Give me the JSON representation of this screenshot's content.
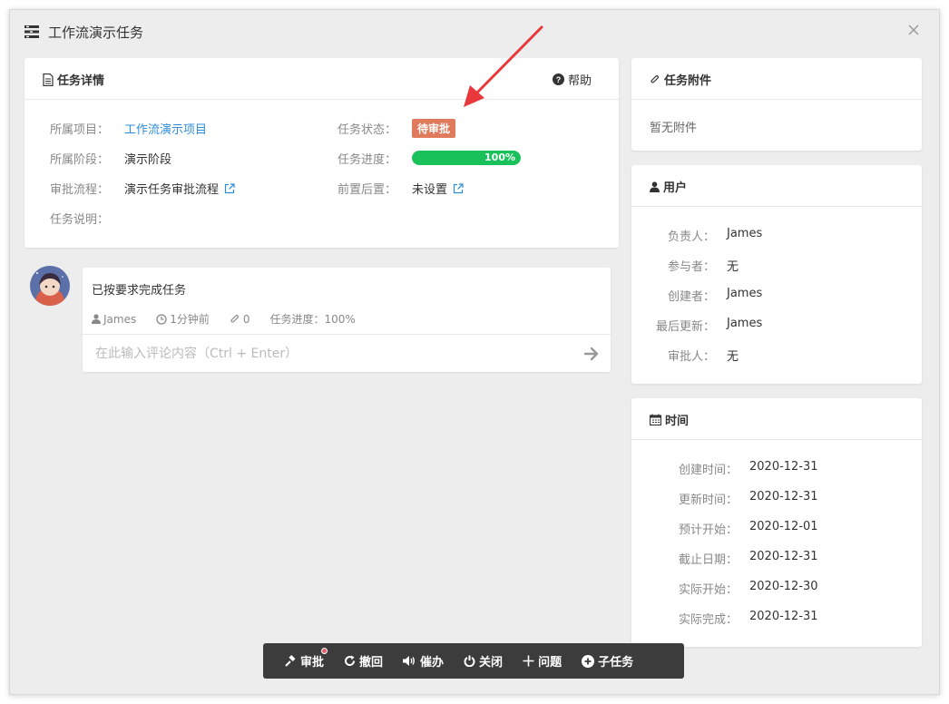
{
  "window": {
    "title": "工作流演示任务"
  },
  "detail": {
    "title": "任务详情",
    "help_label": "帮助",
    "project_label": "所属项目：",
    "project_value": "工作流演示项目",
    "stage_label": "所属阶段：",
    "stage_value": "演示阶段",
    "flow_label": "审批流程：",
    "flow_value": "演示任务审批流程",
    "desc_label": "任务说明：",
    "status_label": "任务状态：",
    "status_value": "待审批",
    "progress_label": "任务进度：",
    "progress_value": "100%",
    "progress_fraction": 1.0,
    "prereq_label": "前置后置：",
    "prereq_value": "未设置"
  },
  "comment": {
    "text": "已按要求完成任务",
    "author": "James",
    "time": "1分钟前",
    "attachments": "0",
    "progress": "任务进度：100%",
    "input_placeholder": "在此输入评论内容（Ctrl + Enter）"
  },
  "attachments": {
    "title": "任务附件",
    "empty_text": "暂无附件"
  },
  "users": {
    "title": "用户",
    "rows": [
      {
        "label": "负责人：",
        "value": "James"
      },
      {
        "label": "参与者：",
        "value": "无"
      },
      {
        "label": "创建者：",
        "value": "James"
      },
      {
        "label": "最后更新：",
        "value": "James"
      },
      {
        "label": "审批人：",
        "value": "无"
      }
    ]
  },
  "times": {
    "title": "时间",
    "rows": [
      {
        "label": "创建时间：",
        "value": "2020-12-31"
      },
      {
        "label": "更新时间：",
        "value": "2020-12-31"
      },
      {
        "label": "预计开始：",
        "value": "2020-12-01"
      },
      {
        "label": "截止日期：",
        "value": "2020-12-31"
      },
      {
        "label": "实际开始：",
        "value": "2020-12-30"
      },
      {
        "label": "实际完成：",
        "value": "2020-12-31"
      }
    ]
  },
  "toolbar": {
    "approve": "审批",
    "revoke": "撤回",
    "urge": "催办",
    "close": "关闭",
    "issue": "问题",
    "subtask": "子任务"
  },
  "colors": {
    "accent": "#2e8ed9",
    "status_badge": "#e07a5c",
    "progress": "#19c15b",
    "toolbar_bg": "#3c3c3c",
    "annotation_arrow": "#e8383b"
  }
}
